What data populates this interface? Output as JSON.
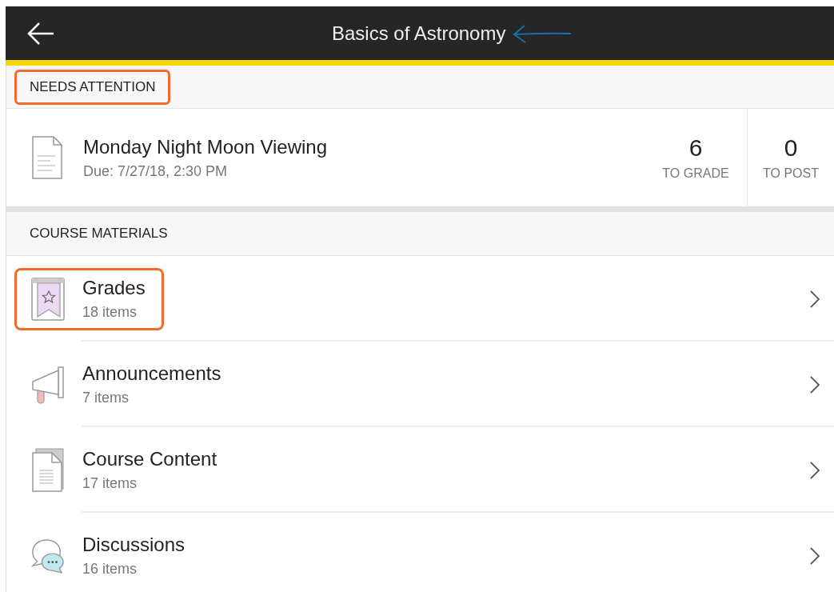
{
  "header": {
    "title": "Basics of Astronomy",
    "annotation_arrow": true
  },
  "needs_attention": {
    "heading": "NEEDS ATTENTION",
    "highlighted": true,
    "items": [
      {
        "kind": "document",
        "title": "Monday Night Moon Viewing",
        "due": "Due: 7/27/18, 2:30 PM",
        "stats": [
          {
            "value": "6",
            "label": "TO GRADE"
          },
          {
            "value": "0",
            "label": "TO POST"
          }
        ]
      }
    ]
  },
  "course_materials": {
    "heading": "COURSE MATERIALS",
    "highlighted": false,
    "items": [
      {
        "kind": "grades",
        "title": "Grades",
        "count": "18 items",
        "highlighted": true
      },
      {
        "kind": "announcements",
        "title": "Announcements",
        "count": "7 items",
        "highlighted": false
      },
      {
        "kind": "content",
        "title": "Course Content",
        "count": "17 items",
        "highlighted": false
      },
      {
        "kind": "discussions",
        "title": "Discussions",
        "count": "16 items",
        "highlighted": false
      }
    ]
  }
}
